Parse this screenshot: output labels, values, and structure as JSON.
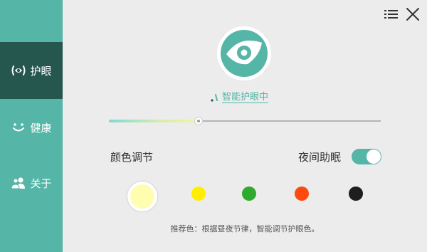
{
  "sidebar": {
    "items": [
      {
        "label": "护眼",
        "icon": "eye-protection-icon",
        "active": true
      },
      {
        "label": "健康",
        "icon": "smile-icon",
        "active": false
      },
      {
        "label": "关于",
        "icon": "users-icon",
        "active": false
      }
    ]
  },
  "window": {
    "menu_icon": "list-menu-icon",
    "close_icon": "close-icon"
  },
  "status": {
    "text": "智能护眼中"
  },
  "slider": {
    "value_fraction": 0.33
  },
  "color_adjust": {
    "title": "颜色调节",
    "swatches": [
      {
        "color": "#fffdb0",
        "selected": true
      },
      {
        "color": "#ffee00",
        "selected": false
      },
      {
        "color": "#2eaa2e",
        "selected": false
      },
      {
        "color": "#ff4a0f",
        "selected": false
      },
      {
        "color": "#1e1e1e",
        "selected": false
      }
    ],
    "hint": "推荐色：根据昼夜节律，智能调节护眼色。"
  },
  "night_mode": {
    "label": "夜间助眠",
    "enabled": true
  },
  "colors": {
    "accent": "#55b5a6",
    "sidebar_active": "#26574f",
    "background": "#ececec"
  }
}
